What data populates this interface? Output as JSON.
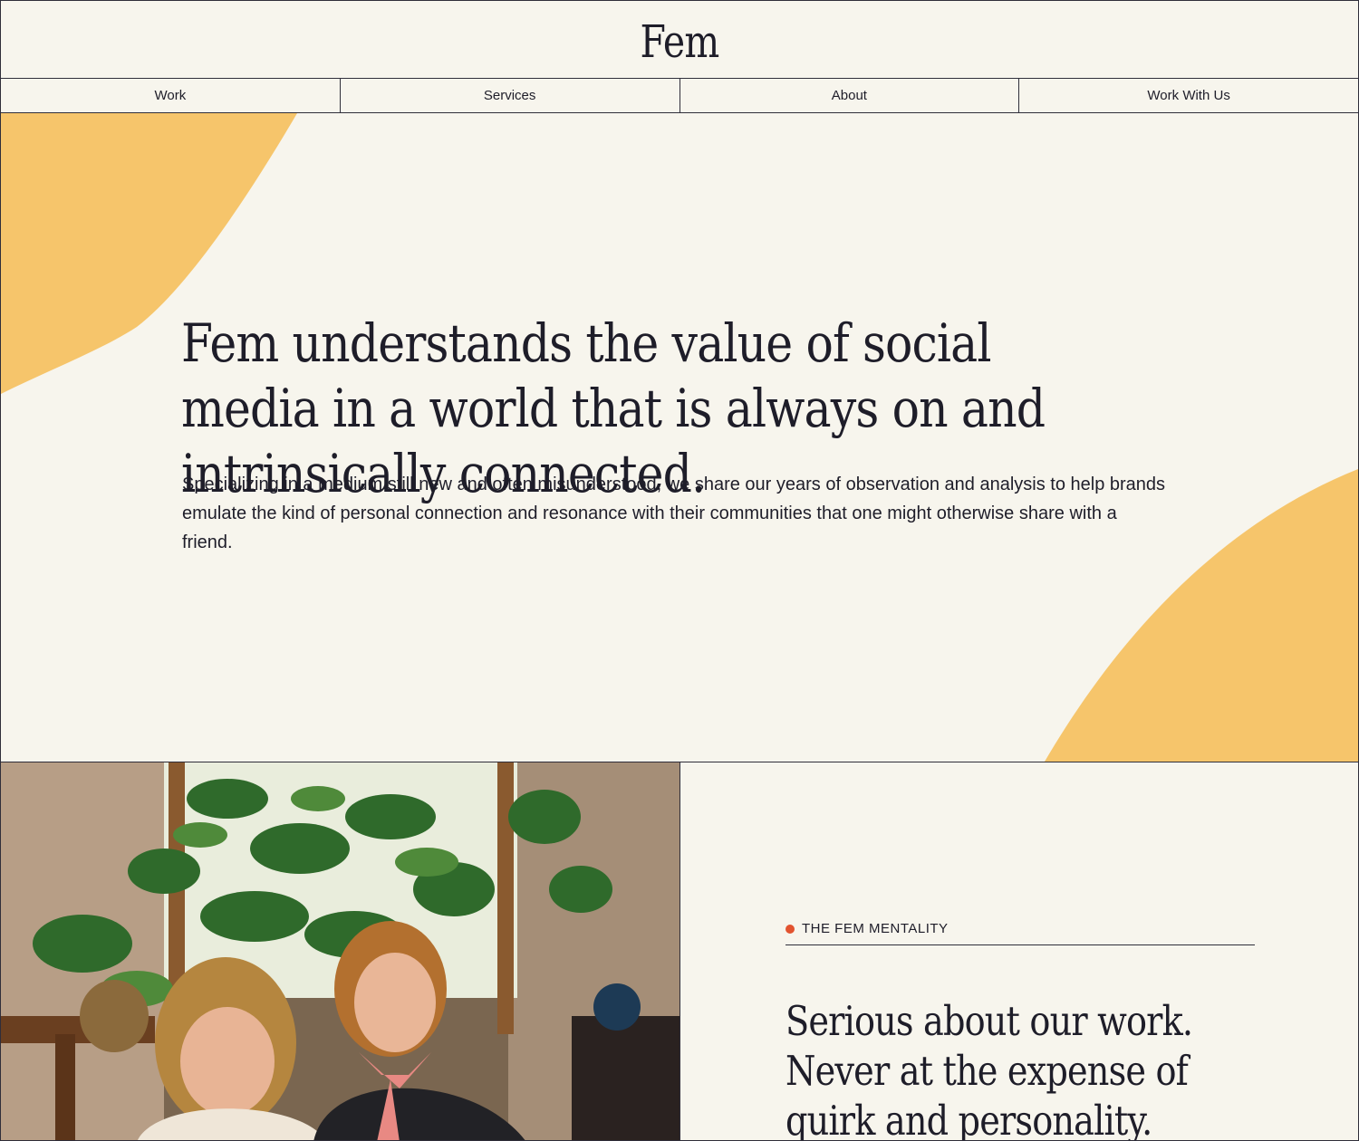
{
  "brand": {
    "logo_text": "Fem",
    "accent_color": "#f6c56b",
    "background_color": "#f7f5ed",
    "text_color": "#1e1d29",
    "dot_color": "#e2532f"
  },
  "nav": {
    "items": [
      {
        "label": "Work"
      },
      {
        "label": "Services"
      },
      {
        "label": "About"
      },
      {
        "label": "Work With Us"
      }
    ]
  },
  "hero": {
    "headline": "Fem understands the value of social media in a world that is always on and intrinsically connected.",
    "body": "Specializing in a medium still new and often misunderstood, we share our years of observation and analysis to help brands emulate the kind of personal connection and resonance with their communities that one might otherwise share with a friend."
  },
  "mentality": {
    "eyebrow": "THE FEM MENTALITY",
    "heading": "Serious about our work. Never at the expense of quirk and personality."
  }
}
